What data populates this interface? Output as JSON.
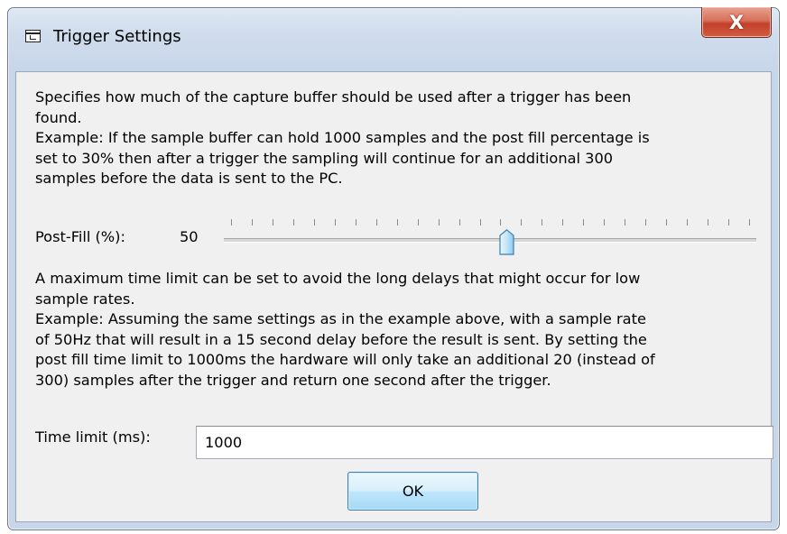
{
  "window": {
    "title": "Trigger Settings",
    "icon": "window-icon",
    "close_label": "X"
  },
  "description_1": {
    "lines": [
      "Specifies how much of the capture buffer should be used after a trigger has been",
      "found.",
      "Example: If the sample buffer can hold 1000 samples and the post fill percentage is",
      "set to 30% then after a trigger the sampling will continue for an additional 300",
      "samples before the data is sent to the PC."
    ]
  },
  "post_fill": {
    "label": "Post-Fill (%):",
    "value": "50",
    "slider_fraction": 0.5
  },
  "description_2": {
    "lines": [
      "A maximum time limit can be set to avoid the long delays that might occur for low",
      "sample rates.",
      "Example: Assuming the same settings as in the example above, with a sample rate",
      "of 50Hz that will result in a 15 second delay before the result is sent. By setting the",
      "post fill time limit to 1000ms the hardware will only take an additional 20 (instead of",
      "300) samples after the trigger and return one second after the trigger."
    ]
  },
  "time_limit": {
    "label": "Time limit (ms):",
    "value": "1000"
  },
  "buttons": {
    "ok_label": "OK"
  }
}
